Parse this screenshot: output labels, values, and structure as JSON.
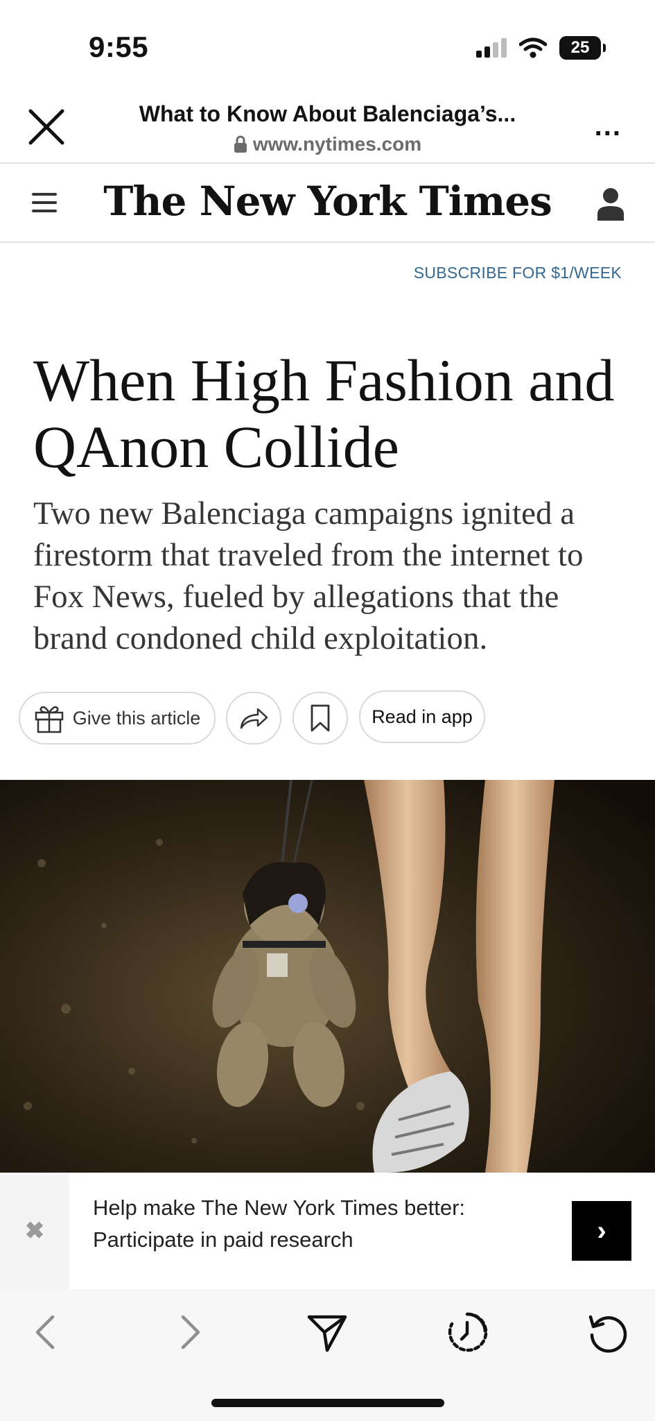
{
  "status_bar": {
    "time": "9:55",
    "battery": "25"
  },
  "browser": {
    "page_title": "What to Know About Balenciaga’s...",
    "url": "www.nytimes.com",
    "more_label": "..."
  },
  "nyt_header": {
    "logo": "The New York Times"
  },
  "subscribe_label": "SUBSCRIBE FOR $1/WEEK",
  "article": {
    "headline": "When High Fashion and QAnon Collide",
    "summary": "Two new Balenciaga campaigns ignited a firestorm that traveled from the internet to Fox News, fueled by allegations that the brand condoned child exploitation."
  },
  "actions": {
    "give_label": "Give this article",
    "read_in_app_label": "Read in app"
  },
  "banner": {
    "text": "Help make The New York Times better: Participate in paid research",
    "close_glyph": "✖",
    "arrow_glyph": "›"
  },
  "icons": {
    "close": "close-icon",
    "lock": "lock-icon",
    "menu": "hamburger-menu-icon",
    "user": "user-icon",
    "gift": "gift-icon",
    "share": "share-icon",
    "bookmark": "bookmark-icon",
    "back": "back-icon",
    "forward": "forward-icon",
    "send": "send-icon",
    "history": "history-icon",
    "reload": "reload-icon"
  },
  "colors": {
    "link_blue": "#326891",
    "text": "#121212",
    "summary_text": "#363636"
  }
}
